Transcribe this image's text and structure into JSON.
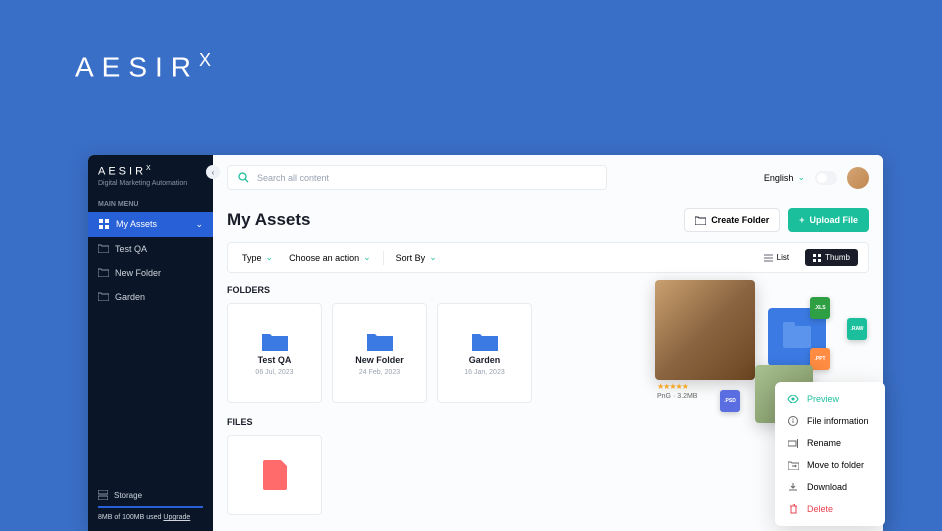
{
  "brand": "AESIR",
  "sidebar": {
    "brand": "AESIR",
    "tagline": "Digital Marketing Automation",
    "section": "MAIN MENU",
    "items": [
      {
        "label": "My Assets",
        "active": true
      },
      {
        "label": "Test QA"
      },
      {
        "label": "New Folder"
      },
      {
        "label": "Garden"
      }
    ],
    "storage_label": "Storage",
    "usage": "8MB of 100MB used",
    "upgrade": "Upgrade"
  },
  "topbar": {
    "search_placeholder": "Search all content",
    "language": "English"
  },
  "page": {
    "title": "My Assets",
    "create_folder": "Create Folder",
    "upload": "Upload File"
  },
  "filters": {
    "type": "Type",
    "action": "Choose an action",
    "sort": "Sort By",
    "list": "List",
    "thumb": "Thumb"
  },
  "sections": {
    "folders": "FOLDERS",
    "files": "FILES"
  },
  "folders": [
    {
      "name": "Test QA",
      "date": "06 Jul, 2023"
    },
    {
      "name": "New Folder",
      "date": "24 Feb, 2023"
    },
    {
      "name": "Garden",
      "date": "16 Jan, 2023"
    }
  ],
  "preview": {
    "meta": "PnG · 3.2MB",
    "badges": {
      "psd": ".PSD",
      "xls": ".XLS",
      "raw": ".RAW",
      "ppt": ".PPT"
    }
  },
  "context_menu": [
    {
      "label": "Preview",
      "cls": "preview"
    },
    {
      "label": "File information",
      "cls": ""
    },
    {
      "label": "Rename",
      "cls": ""
    },
    {
      "label": "Move to folder",
      "cls": ""
    },
    {
      "label": "Download",
      "cls": ""
    },
    {
      "label": "Delete",
      "cls": "delete"
    }
  ]
}
